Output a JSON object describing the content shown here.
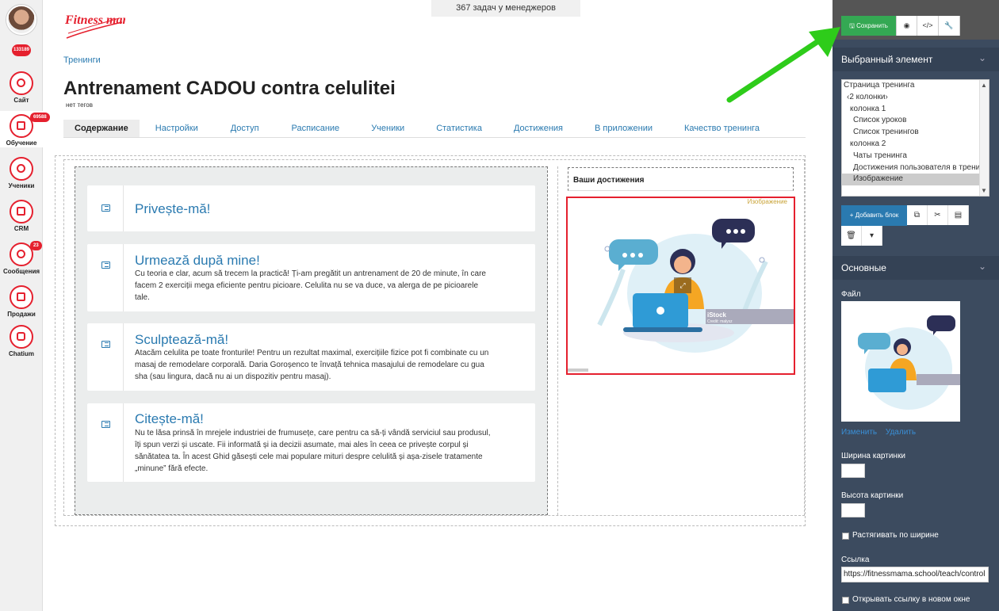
{
  "nav": {
    "counter": "133189",
    "items": [
      {
        "label": "Сайт",
        "badge": ""
      },
      {
        "label": "Обучение",
        "badge": "69588"
      },
      {
        "label": "Ученики",
        "badge": ""
      },
      {
        "label": "CRM",
        "badge": ""
      },
      {
        "label": "Сообщения",
        "badge": "23"
      },
      {
        "label": "Продажи",
        "badge": ""
      },
      {
        "label": "Chatium",
        "badge": ""
      }
    ]
  },
  "top_counter": "367 задач у менеджеров",
  "logo_text": "Fitness mama",
  "breadcrumb": "Тренинги",
  "title": "Antrenament CADOU contra celulitei",
  "tags": "нет тегов",
  "tabs": [
    "Содержание",
    "Настройки",
    "Доступ",
    "Расписание",
    "Ученики",
    "Статистика",
    "Достижения",
    "В приложении",
    "Качество тренинга"
  ],
  "lessons": [
    {
      "title": "Privește-mă!",
      "desc": ""
    },
    {
      "title": "Urmează după mine!",
      "desc": "Cu teoria e clar, acum să trecem la practică! Ți-am pregătit un antrenament de 20 de minute, în care facem 2 exerciții mega eficiente pentru picioare. Celulita nu se va duce, va alerga de pe picioarele tale."
    },
    {
      "title": "Sculptează-mă!",
      "desc": "Atacăm celulita pe toate fronturile! Pentru un rezultat maximal, exercițiile fizice pot fi combinate cu un masaj de remodelare corporală. Daria Goroșenco te învață tehnica masajului de remodelare cu gua sha (sau lingura, dacă nu ai un dispozitiv pentru masaj)."
    },
    {
      "title": "Citește-mă!",
      "desc": "Nu te lăsa prinsă în mrejele industriei de frumusețe, care pentru ca să-ți vândă serviciul sau produsul, îți spun verzi și uscate. Fii informată și ia decizii asumate, mai ales în ceea ce privește corpul și sănătatea ta. În acest Ghid găsești cele mai populare mituri despre celulită și așa-zisele tratamente „minune” fără efecte."
    }
  ],
  "achievements_title": "Ваши достижения",
  "image_label": "Изображение",
  "istock": "iStock",
  "istock_credit": "Credit: malyxz",
  "toolbar": {
    "save": "Сохранить"
  },
  "panel": {
    "selected_title": "Выбранный элемент",
    "tree": [
      "Страница тренинга",
      "‹2 колонки›",
      "колонка 1",
      "Список уроков",
      "Список тренингов",
      "колонка 2",
      "Чаты тренинга",
      "Достижения пользователя в тренинге",
      "Изображение"
    ],
    "add_block": "+ Добавить блок",
    "basic_title": "Основные",
    "file_label": "Файл",
    "change": "Изменить",
    "delete": "Удалить",
    "width_label": "Ширина картинки",
    "height_label": "Высота картинки",
    "stretch_label": "Растягивать по ширине",
    "link_label": "Ссылка",
    "link_value": "https://fitnessmama.school/teach/control",
    "new_window_label": "Открывать ссылку в новом окне"
  },
  "colors": {
    "accent": "#2a7ab0",
    "brand_red": "#e5202e",
    "panel": "#3c4b5f",
    "save_green": "#34a853",
    "arrow": "#2ecc1a"
  }
}
